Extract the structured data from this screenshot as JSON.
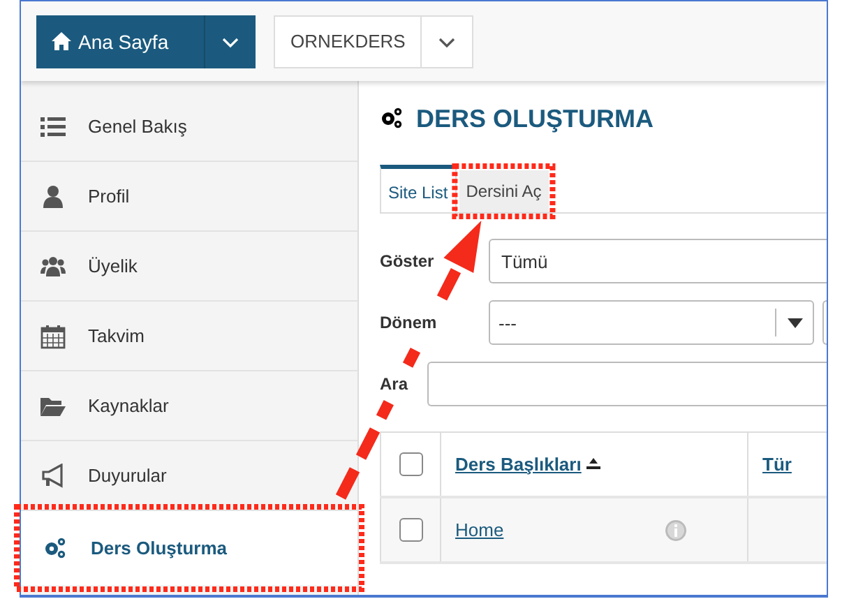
{
  "top_bar": {
    "home_button": {
      "label": "Ana Sayfa"
    },
    "site_button": {
      "label": "ORNEKDERS"
    }
  },
  "sidebar": {
    "items": [
      {
        "label": "Genel Bakış",
        "kind": "list",
        "selected": false
      },
      {
        "label": "Profil",
        "kind": "user",
        "selected": false
      },
      {
        "label": "Üyelik",
        "kind": "users",
        "selected": false
      },
      {
        "label": "Takvim",
        "kind": "calendar",
        "selected": false
      },
      {
        "label": "Kaynaklar",
        "kind": "folder",
        "selected": false
      },
      {
        "label": "Duyurular",
        "kind": "megaphone",
        "selected": false
      },
      {
        "label": "Ders Oluşturma",
        "kind": "gears",
        "selected": true
      }
    ]
  },
  "page": {
    "title": "DERS OLUŞTURMA",
    "tabs": [
      {
        "label": "Site List",
        "selected": true
      },
      {
        "label": "Dersini Aç",
        "selected": false
      }
    ],
    "filters": [
      {
        "label": "Göster",
        "kind": "select",
        "value": "Tümü"
      },
      {
        "label": "Dönem",
        "kind": "combo",
        "value": "---"
      },
      {
        "label": "Ara",
        "kind": "text"
      }
    ],
    "table": {
      "select_all_checked": false,
      "columns": [
        "Ders Başlıkları",
        "Tür"
      ],
      "rows": [
        {
          "title": "Home",
          "checked": false
        }
      ]
    }
  }
}
